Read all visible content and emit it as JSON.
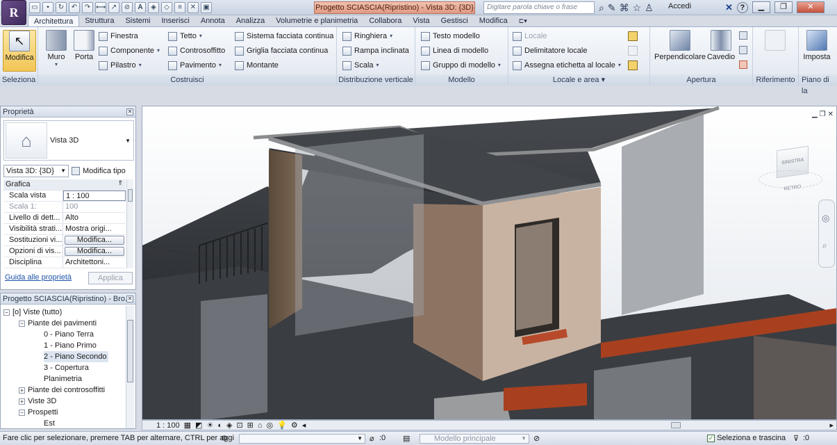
{
  "app": {
    "window_title": "Progetto SCIASCIA(Ripristino) - Vista 3D: {3D}",
    "search_placeholder": "Digitare parola chiave o frase",
    "signin": "Accedi"
  },
  "tabs": [
    "Architettura",
    "Struttura",
    "Sistemi",
    "Inserisci",
    "Annota",
    "Analizza",
    "Volumetrie e planimetria",
    "Collabora",
    "Vista",
    "Gestisci",
    "Modifica"
  ],
  "ribbon": {
    "seleziona": {
      "label": "Seleziona",
      "modifica": "Modifica"
    },
    "costruisci": {
      "label": "Costruisci",
      "muro": "Muro",
      "porta": "Porta",
      "finestra": "Finestra",
      "componente": "Componente",
      "pilastro": "Pilastro",
      "tetto": "Tetto",
      "controsoffitto": "Controsoffitto",
      "pavimento": "Pavimento",
      "sistema_facciata": "Sistema facciata continua",
      "griglia_facciata": "Griglia facciata continua",
      "montante": "Montante"
    },
    "distribuzione": {
      "label": "Distribuzione verticale",
      "ringhiera": "Ringhiera",
      "rampa": "Rampa inclinata",
      "scala": "Scala"
    },
    "modello": {
      "label": "Modello",
      "testo": "Testo modello",
      "linea": "Linea di modello",
      "gruppo": "Gruppo di modello"
    },
    "locale": {
      "label": "Locale e area",
      "locale": "Locale",
      "delimitatore": "Delimitatore locale",
      "etichetta": "Assegna etichetta  al locale"
    },
    "apertura": {
      "label": "Apertura",
      "perpendicolare": "Perpendicolare",
      "cavedio": "Cavedio"
    },
    "riferimento": {
      "label": "Riferimento"
    },
    "piano": {
      "label": "Piano di la",
      "imposta": "Imposta"
    }
  },
  "properties": {
    "title": "Proprietà",
    "type_name": "Vista 3D",
    "view_selector": "Vista 3D: {3D}",
    "edit_type": "Modifica tipo",
    "category": "Grafica",
    "rows": [
      {
        "k": "Scala vista",
        "v": "1 : 100"
      },
      {
        "k": "Scala  1:",
        "v": "100"
      },
      {
        "k": "Livello di dett...",
        "v": "Alto"
      },
      {
        "k": "Visibilità strati...",
        "v": "Mostra origi..."
      },
      {
        "k": "Sostituzioni vi...",
        "v": "Modifica..."
      },
      {
        "k": "Opzioni di vis...",
        "v": "Modifica..."
      },
      {
        "k": "Disciplina",
        "v": "Architettoni..."
      }
    ],
    "help_link": "Guida alle proprietà",
    "apply": "Applica"
  },
  "browser": {
    "title": "Progetto SCIASCIA(Ripristino) - Bro...",
    "items": [
      {
        "label": "Viste (tutto)",
        "level": 0,
        "exp": "−"
      },
      {
        "label": "Piante dei pavimenti",
        "level": 1,
        "exp": "−"
      },
      {
        "label": "0 - Piano Terra",
        "level": 2,
        "exp": ""
      },
      {
        "label": "1 - Piano Primo",
        "level": 2,
        "exp": ""
      },
      {
        "label": "2 - Piano Secondo",
        "level": 2,
        "exp": ""
      },
      {
        "label": "3 - Copertura",
        "level": 2,
        "exp": ""
      },
      {
        "label": "Planimetria",
        "level": 2,
        "exp": ""
      },
      {
        "label": "Piante dei controsoffitti",
        "level": 1,
        "exp": "+"
      },
      {
        "label": "Viste 3D",
        "level": 1,
        "exp": "+"
      },
      {
        "label": "Prospetti",
        "level": 1,
        "exp": "−"
      },
      {
        "label": "Est",
        "level": 2,
        "exp": ""
      }
    ]
  },
  "viewcube": {
    "left": "SINISTRA",
    "front": "RETRO"
  },
  "viewcontrol": {
    "scale": "1 : 100"
  },
  "status": {
    "hint": "Fare clic per selezionare, premere TAB per alternare, CTRL per aggi",
    "count": ":0",
    "model": "Modello principale",
    "select_drag": "Seleziona e trascina",
    "filter": ":0"
  }
}
